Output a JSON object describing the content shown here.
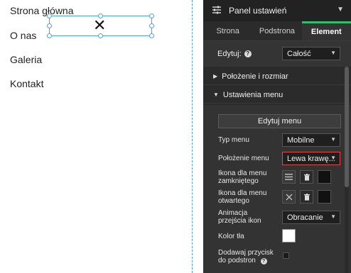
{
  "canvas": {
    "menu_items": [
      "Strona główna",
      "O nas",
      "Galeria",
      "Kontakt"
    ]
  },
  "panel": {
    "title": "Panel ustawień",
    "tabs": [
      {
        "label": "Strona",
        "active": false
      },
      {
        "label": "Podstrona",
        "active": false
      },
      {
        "label": "Element",
        "active": true
      }
    ],
    "edit_label": "Edytuj:",
    "edit_value": "Całość",
    "sections": {
      "position": "Położenie i rozmiar",
      "menu_settings": "Ustawienia menu"
    },
    "edit_menu_button": "Edytuj menu",
    "menu_type_label": "Typ menu",
    "menu_type_value": "Mobilne",
    "menu_position_label": "Położenie menu",
    "menu_position_value": "Lewa krawę...",
    "icon_closed_label_1": "Ikona dla menu",
    "icon_closed_label_2": "zamkniętego",
    "icon_open_label_1": "Ikona dla menu",
    "icon_open_label_2": "otwartego",
    "animation_label_1": "Animacja",
    "animation_label_2": "przejścia ikon",
    "animation_value": "Obracanie",
    "bg_color_label": "Kolor tła",
    "add_button_label_1": "Dodawaj przycisk",
    "add_button_label_2": "do podstron"
  },
  "colors": {
    "accent": "#2dbf6c",
    "focus_border": "#e04a4a",
    "guide": "#4aa3df",
    "bg_color_value": "#ffffff"
  }
}
